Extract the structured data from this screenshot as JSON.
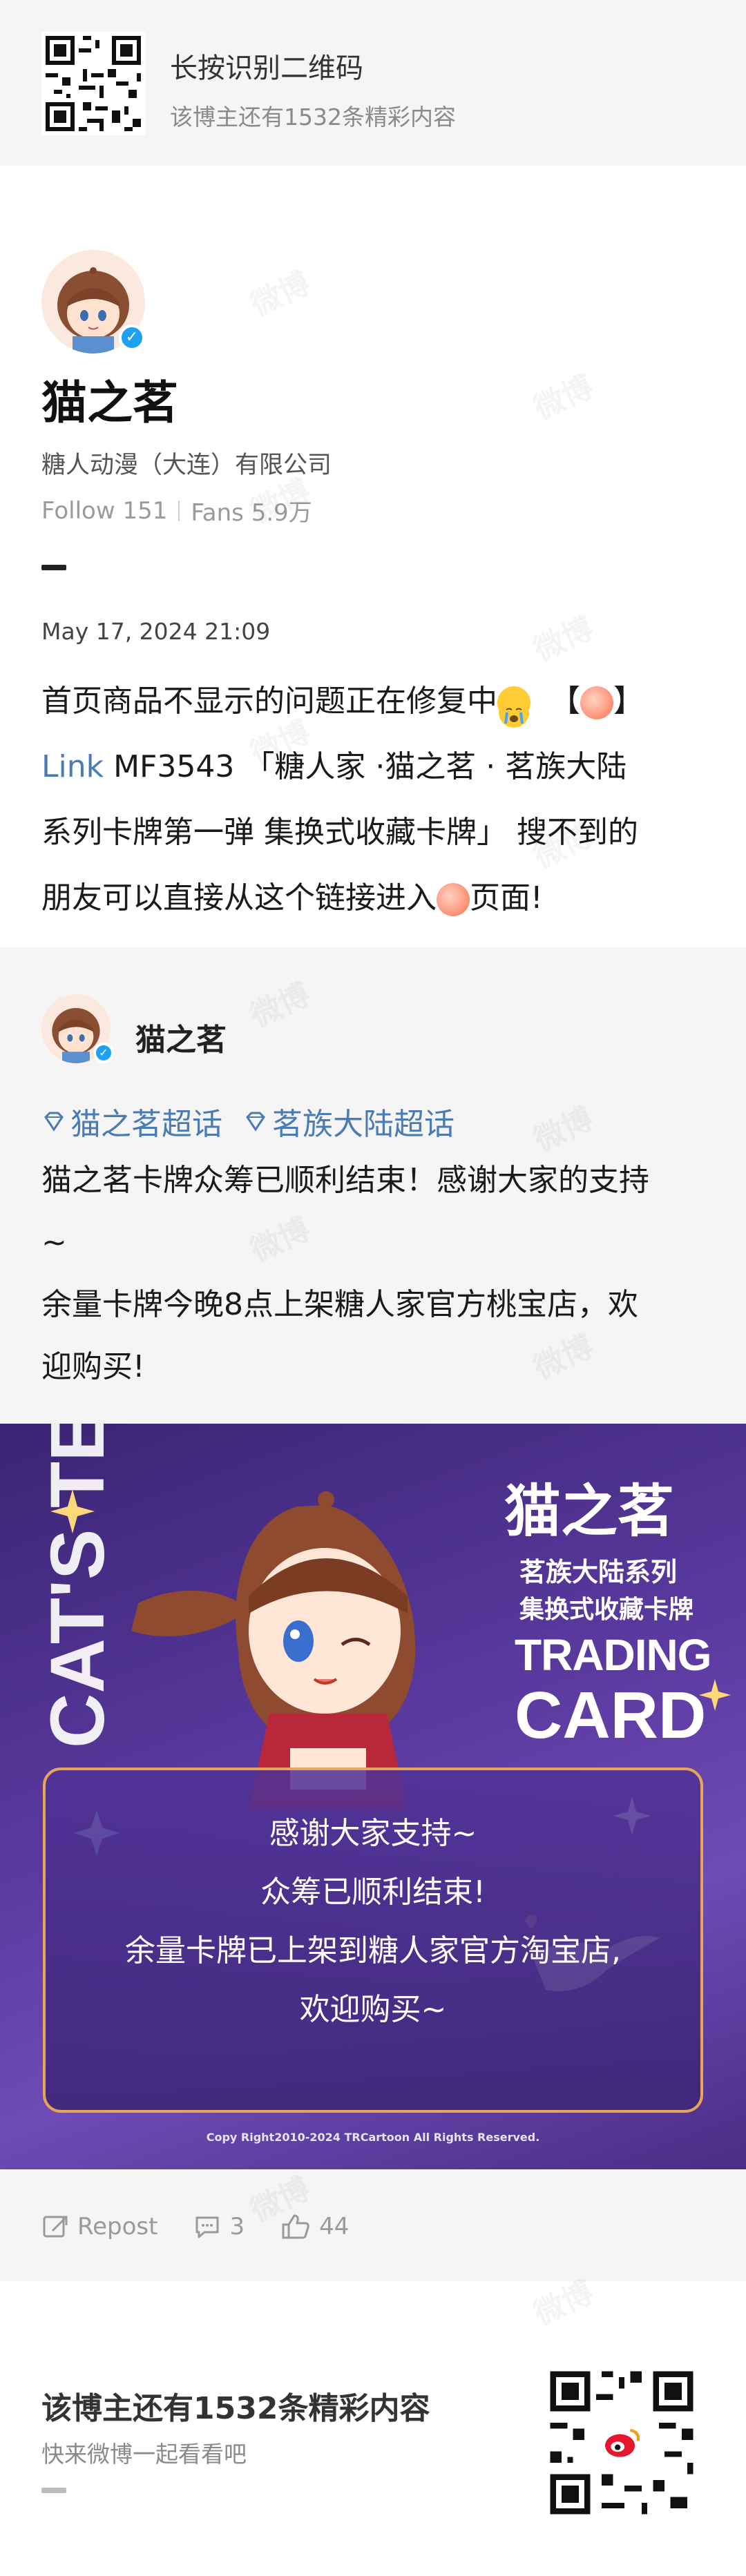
{
  "top_banner": {
    "title": "长按识别二维码",
    "subtitle": "该博主还有1532条精彩内容"
  },
  "profile": {
    "name": "猫之茗",
    "company": "糖人动漫（大连）有限公司",
    "follow_label": "Follow 151",
    "fans_label": "Fans 5.9万"
  },
  "post": {
    "date": "May 17, 2024 21:09",
    "line1": "首页商品不显示的问题正在修复中",
    "bracket_open": "【",
    "bracket_close": "】",
    "link_text": "Link",
    "line2_rest": " MF3543 「糖人家 ·猫之茗 · 茗族大陆",
    "line3": "系列卡牌第一弹 集换式收藏卡牌」 搜不到的",
    "line4_a": "朋友可以直接从这个链接进入",
    "line4_b": "页面!"
  },
  "repost": {
    "author": "猫之茗",
    "topics": [
      "猫之茗超话",
      "茗族大陆超话"
    ],
    "line1": "猫之茗卡牌众筹已顺利结束！感谢大家的支持",
    "line2": "~",
    "line3": "余量卡牌今晚8点上架糖人家官方桃宝店，欢",
    "line4": "迎购买!"
  },
  "promo_image": {
    "title_cn": "猫之茗",
    "series": "茗族大陆系列",
    "kind": "集换式收藏卡牌",
    "trading": "TRADING",
    "card": "CARD",
    "side_text": "CAT'S TEA",
    "lines": [
      "感谢大家支持~",
      "众筹已顺利结束!",
      "余量卡牌已上架到糖人家官方淘宝店,",
      "欢迎购买~"
    ],
    "copyright": "Copy Right2010-2024 TRCartoon All Rights Reserved."
  },
  "actions": {
    "repost_label": "Repost",
    "comments": "3",
    "likes": "44"
  },
  "bottom": {
    "title": "该博主还有1532条精彩内容",
    "subtitle": "快来微博一起看看吧"
  },
  "watermark_text": "微博",
  "colors": {
    "link": "#4a7bb5",
    "promo_bg": "#5b3aa0",
    "verified": "#1da1f2"
  },
  "icons": [
    "qr-code-icon",
    "verified-badge-icon",
    "super-topic-diamond-icon",
    "repost-icon",
    "comment-icon",
    "like-icon"
  ]
}
